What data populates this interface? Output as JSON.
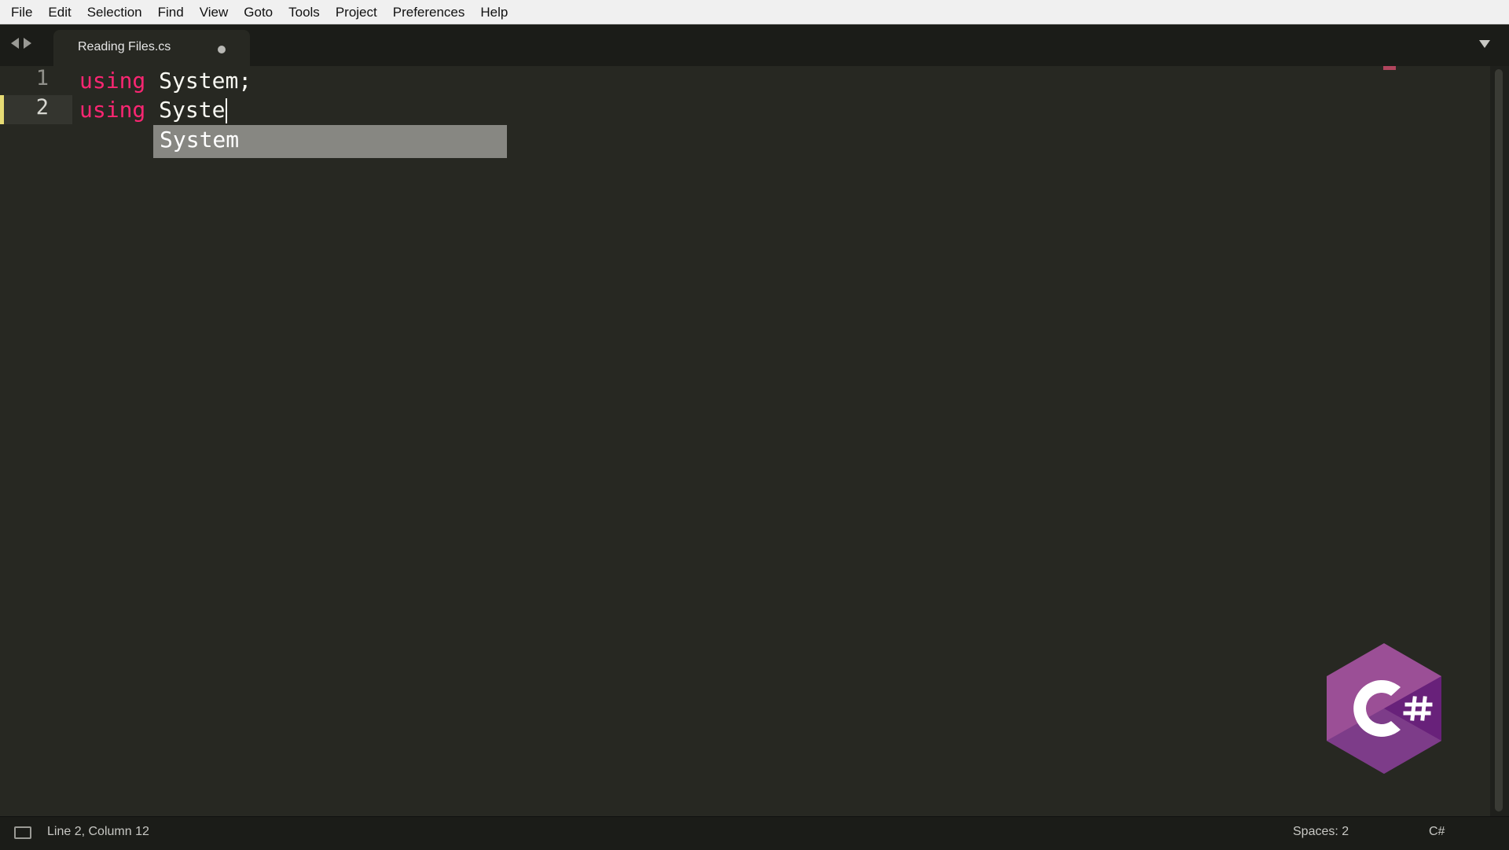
{
  "menu": [
    "File",
    "Edit",
    "Selection",
    "Find",
    "View",
    "Goto",
    "Tools",
    "Project",
    "Preferences",
    "Help"
  ],
  "tab": {
    "title": "Reading Files.cs",
    "modified": true
  },
  "editor": {
    "line_numbers": [
      "1",
      "2"
    ],
    "lines": [
      {
        "keyword": "using",
        "rest": "System;"
      },
      {
        "keyword": "using",
        "rest": "Syste"
      }
    ]
  },
  "autocomplete": {
    "items": [
      "System"
    ]
  },
  "status": {
    "position": "Line 2, Column 12",
    "spaces": "Spaces: 2",
    "syntax": "C#"
  },
  "logo": {
    "text": "C#",
    "color": "#9b4f96"
  },
  "colors": {
    "background": "#272822",
    "keyword": "#f92672",
    "text": "#f8f8f2"
  }
}
